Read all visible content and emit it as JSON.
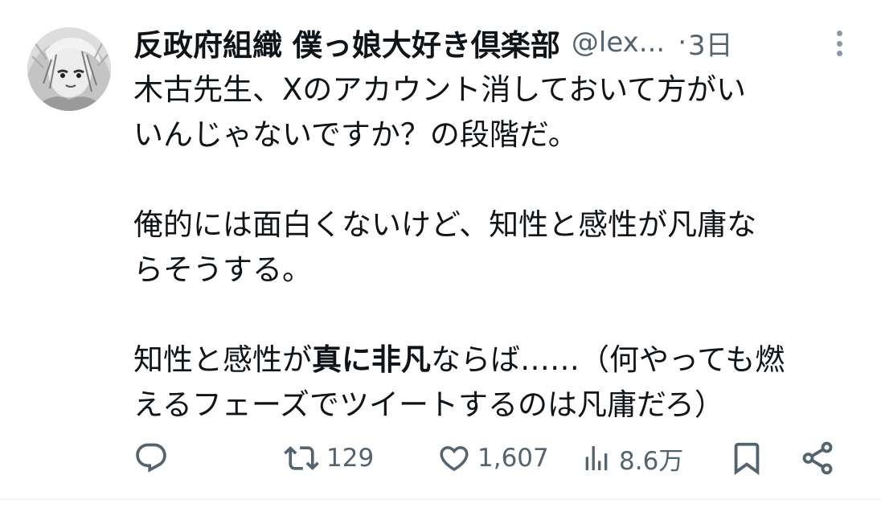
{
  "tweet": {
    "display_name": "反政府組織 僕っ娘大好き倶楽部",
    "handle": "@lex...",
    "separator": "·",
    "time": "3日",
    "body": {
      "p1": {
        "line1": "木古先生、Xのアカウント消しておいて方がい",
        "line2": "いんじゃないですか？の段階だ。"
      },
      "p2": {
        "line1": "俺的には面白くないけど、知性と感性が凡庸な",
        "line2": "らそうする。"
      },
      "p3": {
        "line1_a": "知性と感性が",
        "line1_bold": "真に非凡",
        "line1_b": "ならば……（何やっても燃",
        "line2": "えるフェーズでツイートするのは凡庸だろ）"
      }
    }
  },
  "actions": {
    "reply": {
      "icon": "reply-icon",
      "count": ""
    },
    "retweet": {
      "icon": "retweet-icon",
      "count": "129"
    },
    "like": {
      "icon": "heart-icon",
      "count": "1,607"
    },
    "views": {
      "icon": "views-icon",
      "count": "8.6万"
    },
    "bookmark": {
      "icon": "bookmark-icon",
      "count": ""
    },
    "share": {
      "icon": "share-icon",
      "count": ""
    }
  },
  "colors": {
    "text_primary": "#0f1419",
    "text_secondary": "#536471",
    "more_dots": "#8b98a5"
  }
}
